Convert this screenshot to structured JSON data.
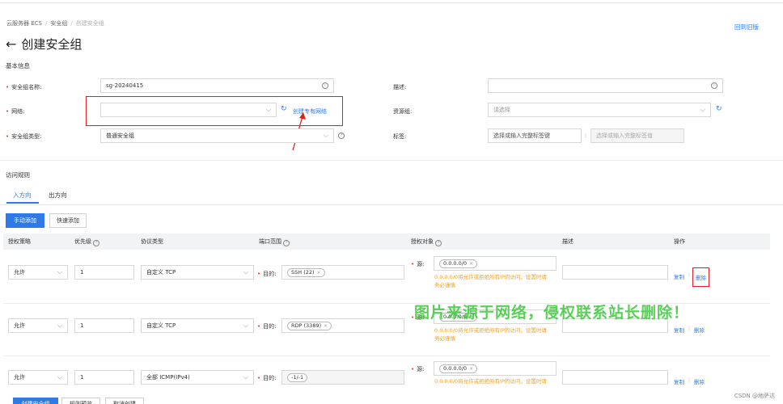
{
  "breadcrumb": {
    "items": [
      "云服务器 ECS",
      "安全组",
      "创建安全组"
    ]
  },
  "back_old_version": "回到旧版",
  "page_title": "创建安全组",
  "basic_info": {
    "section_title": "基本信息",
    "name_label": "安全组名称:",
    "name_value": "sg-20240415",
    "network_label": "网络:",
    "network_value": "",
    "create_vpc_link": "创建专有网络",
    "type_label": "安全组类型:",
    "type_value": "普通安全组",
    "desc_label": "描述:",
    "desc_value": "",
    "resource_group_label": "资源组:",
    "resource_group_placeholder": "请选择",
    "tags_label": "标签:",
    "tag_key_placeholder": "选择或输入完整标签键",
    "tag_value_placeholder": "选择或输入完整标签值"
  },
  "access_rules": {
    "section_title": "访问规则",
    "tabs": [
      "入方向",
      "出方向"
    ],
    "manual_add": "手动添加",
    "quick_add": "快速添加",
    "columns": [
      "授权策略",
      "优先级",
      "协议类型",
      "端口范围",
      "授权对象",
      "描述",
      "操作"
    ],
    "dest_label": "目的:",
    "src_label": "源:",
    "warning": [
      "0.0.0.0/0将允许或拒绝所有IP的访问，设置时请",
      "务必谨慎"
    ],
    "copy_label": "复制",
    "delete_label": "删除",
    "rows": [
      {
        "policy": "允许",
        "priority": "1",
        "protocol": "自定义 TCP",
        "port": "SSH (22)",
        "source": "0.0.0.0/0",
        "desc": ""
      },
      {
        "policy": "允许",
        "priority": "1",
        "protocol": "自定义 TCP",
        "port": "RDP (3389)",
        "source": "0.0.0.0/0",
        "desc": ""
      },
      {
        "policy": "允许",
        "priority": "1",
        "protocol": "全部 ICMP(IPv4)",
        "port": "-1/-1",
        "source": "0.0.0.0/0",
        "desc": ""
      }
    ]
  },
  "footer": {
    "create": "创建安全组",
    "preview": "规则预览",
    "cancel": "取消创建"
  },
  "watermark": "图片来源于网络，侵权联系站长删除！",
  "csdn": "CSDN @地萨达",
  "colors": {
    "accent": "#2f7ae5",
    "required": "#e4393c",
    "warning": "#f0a020",
    "highlight_box": "#e02020",
    "watermark": "#3cc83c"
  },
  "icons": [
    "back-arrow-icon",
    "info-icon",
    "chevron-down-icon",
    "refresh-icon",
    "help-icon",
    "close-icon"
  ]
}
